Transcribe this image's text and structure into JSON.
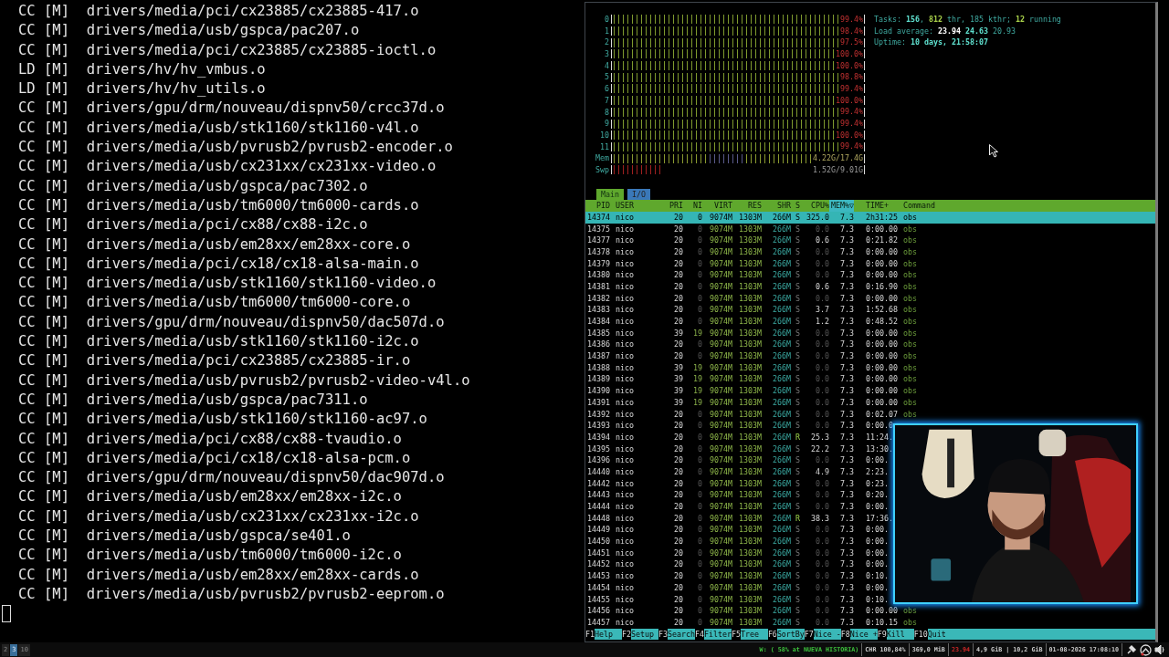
{
  "terminal": {
    "lines": [
      "CC [M]  drivers/media/pci/cx23885/cx23885-417.o",
      "CC [M]  drivers/media/usb/gspca/pac207.o",
      "CC [M]  drivers/media/pci/cx23885/cx23885-ioctl.o",
      "LD [M]  drivers/hv/hv_vmbus.o",
      "LD [M]  drivers/hv/hv_utils.o",
      "CC [M]  drivers/gpu/drm/nouveau/dispnv50/crcc37d.o",
      "CC [M]  drivers/media/usb/stk1160/stk1160-v4l.o",
      "CC [M]  drivers/media/usb/pvrusb2/pvrusb2-encoder.o",
      "CC [M]  drivers/media/usb/cx231xx/cx231xx-video.o",
      "CC [M]  drivers/media/usb/gspca/pac7302.o",
      "CC [M]  drivers/media/usb/tm6000/tm6000-cards.o",
      "CC [M]  drivers/media/pci/cx88/cx88-i2c.o",
      "CC [M]  drivers/media/usb/em28xx/em28xx-core.o",
      "CC [M]  drivers/media/pci/cx18/cx18-alsa-main.o",
      "CC [M]  drivers/media/usb/stk1160/stk1160-video.o",
      "CC [M]  drivers/media/usb/tm6000/tm6000-core.o",
      "CC [M]  drivers/gpu/drm/nouveau/dispnv50/dac507d.o",
      "CC [M]  drivers/media/usb/stk1160/stk1160-i2c.o",
      "CC [M]  drivers/media/pci/cx23885/cx23885-ir.o",
      "CC [M]  drivers/media/usb/pvrusb2/pvrusb2-video-v4l.o",
      "CC [M]  drivers/media/usb/gspca/pac7311.o",
      "CC [M]  drivers/media/usb/stk1160/stk1160-ac97.o",
      "CC [M]  drivers/media/pci/cx88/cx88-tvaudio.o",
      "CC [M]  drivers/media/pci/cx18/cx18-alsa-pcm.o",
      "CC [M]  drivers/gpu/drm/nouveau/dispnv50/dac907d.o",
      "CC [M]  drivers/media/usb/em28xx/em28xx-i2c.o",
      "CC [M]  drivers/media/usb/cx231xx/cx231xx-i2c.o",
      "CC [M]  drivers/media/usb/gspca/se401.o",
      "CC [M]  drivers/media/usb/tm6000/tm6000-i2c.o",
      "CC [M]  drivers/media/usb/em28xx/em28xx-cards.o",
      "CC [M]  drivers/media/usb/pvrusb2/pvrusb2-eeprom.o"
    ],
    "cursor_visible": true
  },
  "htop": {
    "meters": [
      {
        "kind": "cpu",
        "label": "0",
        "level": 0.994,
        "reading": "99.4%"
      },
      {
        "kind": "cpu",
        "label": "1",
        "level": 0.984,
        "reading": "98.4%"
      },
      {
        "kind": "cpu",
        "label": "2",
        "level": 0.975,
        "reading": "97.5%"
      },
      {
        "kind": "cpu",
        "label": "3",
        "level": 1.0,
        "reading": "100.0%"
      },
      {
        "kind": "cpu",
        "label": "4",
        "level": 1.0,
        "reading": "100.0%"
      },
      {
        "kind": "cpu",
        "label": "5",
        "level": 0.988,
        "reading": "98.8%"
      },
      {
        "kind": "cpu",
        "label": "6",
        "level": 0.994,
        "reading": "99.4%"
      },
      {
        "kind": "cpu",
        "label": "7",
        "level": 1.0,
        "reading": "100.0%"
      },
      {
        "kind": "cpu",
        "label": "8",
        "level": 0.994,
        "reading": "99.4%"
      },
      {
        "kind": "cpu",
        "label": "9",
        "level": 0.994,
        "reading": "99.4%"
      },
      {
        "kind": "cpu",
        "label": "10",
        "level": 1.0,
        "reading": "100.0%"
      },
      {
        "kind": "cpu",
        "label": "11",
        "level": 0.994,
        "reading": "99.4%"
      },
      {
        "kind": "mem",
        "label": "Mem",
        "level": 0.92,
        "reading": "4.22G/17.4G"
      },
      {
        "kind": "swap",
        "label": "Swp",
        "level": 0.2,
        "reading": "1.52G/9.01G"
      }
    ],
    "info": [
      [
        {
          "kind": "label",
          "text": "Tasks: "
        },
        {
          "kind": "value",
          "text": "156"
        },
        {
          "kind": "label",
          "text": ", "
        },
        {
          "kind": "green",
          "text": "812"
        },
        {
          "kind": "label",
          "text": " thr, 185 kthr; "
        },
        {
          "kind": "green",
          "text": "12"
        },
        {
          "kind": "label",
          "text": " running"
        }
      ],
      [
        {
          "kind": "label",
          "text": "Load average: "
        },
        {
          "kind": "white",
          "text": "23.94 "
        },
        {
          "kind": "value",
          "text": "24.63 "
        },
        {
          "kind": "label",
          "text": "20.93"
        }
      ],
      [
        {
          "kind": "label",
          "text": "Uptime: "
        },
        {
          "kind": "value",
          "text": "10 days, 21:58:07"
        }
      ]
    ],
    "tabs": [
      {
        "label": "Main",
        "selected": true
      },
      {
        "label": "I/O",
        "selected": false
      }
    ],
    "columns": [
      {
        "label": "PID",
        "sorted": false
      },
      {
        "label": "USER",
        "sorted": false
      },
      {
        "label": "PRI",
        "sorted": false
      },
      {
        "label": "NI",
        "sorted": false
      },
      {
        "label": "VIRT",
        "sorted": false
      },
      {
        "label": "RES",
        "sorted": false
      },
      {
        "label": "SHR",
        "sorted": false
      },
      {
        "label": "S",
        "sorted": false
      },
      {
        "label": "CPU%",
        "sorted": false
      },
      {
        "label": "MEM%▽",
        "sorted": true
      },
      {
        "label": "TIME+",
        "sorted": false
      },
      {
        "label": "Command",
        "sorted": false
      }
    ],
    "rows": [
      {
        "pid": "14374",
        "user": "nico",
        "pri": "20",
        "ni": "0",
        "virt": "9074M",
        "res": "1303M",
        "shr": "266M",
        "s": "S",
        "cpu": "325.0",
        "mem": "7.3",
        "time": "2h31:25",
        "command": "obs",
        "selected": true,
        "running": false
      },
      {
        "pid": "14375",
        "user": "nico",
        "pri": "20",
        "ni": "0",
        "virt": "9074M",
        "res": "1303M",
        "shr": "266M",
        "s": "S",
        "cpu": "0.0",
        "mem": "7.3",
        "time": "0:00.00",
        "command": "obs",
        "selected": false,
        "running": false
      },
      {
        "pid": "14377",
        "user": "nico",
        "pri": "20",
        "ni": "0",
        "virt": "9074M",
        "res": "1303M",
        "shr": "266M",
        "s": "S",
        "cpu": "0.6",
        "mem": "7.3",
        "time": "0:21.82",
        "command": "obs",
        "selected": false,
        "running": false
      },
      {
        "pid": "14378",
        "user": "nico",
        "pri": "20",
        "ni": "0",
        "virt": "9074M",
        "res": "1303M",
        "shr": "266M",
        "s": "S",
        "cpu": "0.0",
        "mem": "7.3",
        "time": "0:00.00",
        "command": "obs",
        "selected": false,
        "running": false
      },
      {
        "pid": "14379",
        "user": "nico",
        "pri": "20",
        "ni": "0",
        "virt": "9074M",
        "res": "1303M",
        "shr": "266M",
        "s": "S",
        "cpu": "0.0",
        "mem": "7.3",
        "time": "0:00.00",
        "command": "obs",
        "selected": false,
        "running": false
      },
      {
        "pid": "14380",
        "user": "nico",
        "pri": "20",
        "ni": "0",
        "virt": "9074M",
        "res": "1303M",
        "shr": "266M",
        "s": "S",
        "cpu": "0.0",
        "mem": "7.3",
        "time": "0:00.00",
        "command": "obs",
        "selected": false,
        "running": false
      },
      {
        "pid": "14381",
        "user": "nico",
        "pri": "20",
        "ni": "0",
        "virt": "9074M",
        "res": "1303M",
        "shr": "266M",
        "s": "S",
        "cpu": "0.6",
        "mem": "7.3",
        "time": "0:16.90",
        "command": "obs",
        "selected": false,
        "running": false
      },
      {
        "pid": "14382",
        "user": "nico",
        "pri": "20",
        "ni": "0",
        "virt": "9074M",
        "res": "1303M",
        "shr": "266M",
        "s": "S",
        "cpu": "0.0",
        "mem": "7.3",
        "time": "0:00.00",
        "command": "obs",
        "selected": false,
        "running": false
      },
      {
        "pid": "14383",
        "user": "nico",
        "pri": "20",
        "ni": "0",
        "virt": "9074M",
        "res": "1303M",
        "shr": "266M",
        "s": "S",
        "cpu": "3.7",
        "mem": "7.3",
        "time": "1:52.68",
        "command": "obs",
        "selected": false,
        "running": false
      },
      {
        "pid": "14384",
        "user": "nico",
        "pri": "20",
        "ni": "0",
        "virt": "9074M",
        "res": "1303M",
        "shr": "266M",
        "s": "S",
        "cpu": "1.2",
        "mem": "7.3",
        "time": "0:48.52",
        "command": "obs",
        "selected": false,
        "running": false
      },
      {
        "pid": "14385",
        "user": "nico",
        "pri": "39",
        "ni": "19",
        "virt": "9074M",
        "res": "1303M",
        "shr": "266M",
        "s": "S",
        "cpu": "0.0",
        "mem": "7.3",
        "time": "0:00.00",
        "command": "obs",
        "selected": false,
        "running": false
      },
      {
        "pid": "14386",
        "user": "nico",
        "pri": "20",
        "ni": "0",
        "virt": "9074M",
        "res": "1303M",
        "shr": "266M",
        "s": "S",
        "cpu": "0.0",
        "mem": "7.3",
        "time": "0:00.00",
        "command": "obs",
        "selected": false,
        "running": false
      },
      {
        "pid": "14387",
        "user": "nico",
        "pri": "20",
        "ni": "0",
        "virt": "9074M",
        "res": "1303M",
        "shr": "266M",
        "s": "S",
        "cpu": "0.0",
        "mem": "7.3",
        "time": "0:00.00",
        "command": "obs",
        "selected": false,
        "running": false
      },
      {
        "pid": "14388",
        "user": "nico",
        "pri": "39",
        "ni": "19",
        "virt": "9074M",
        "res": "1303M",
        "shr": "266M",
        "s": "S",
        "cpu": "0.0",
        "mem": "7.3",
        "time": "0:00.00",
        "command": "obs",
        "selected": false,
        "running": false
      },
      {
        "pid": "14389",
        "user": "nico",
        "pri": "39",
        "ni": "19",
        "virt": "9074M",
        "res": "1303M",
        "shr": "266M",
        "s": "S",
        "cpu": "0.0",
        "mem": "7.3",
        "time": "0:00.00",
        "command": "obs",
        "selected": false,
        "running": false
      },
      {
        "pid": "14390",
        "user": "nico",
        "pri": "39",
        "ni": "19",
        "virt": "9074M",
        "res": "1303M",
        "shr": "266M",
        "s": "S",
        "cpu": "0.0",
        "mem": "7.3",
        "time": "0:00.00",
        "command": "obs",
        "selected": false,
        "running": false
      },
      {
        "pid": "14391",
        "user": "nico",
        "pri": "39",
        "ni": "19",
        "virt": "9074M",
        "res": "1303M",
        "shr": "266M",
        "s": "S",
        "cpu": "0.0",
        "mem": "7.3",
        "time": "0:00.00",
        "command": "obs",
        "selected": false,
        "running": false
      },
      {
        "pid": "14392",
        "user": "nico",
        "pri": "20",
        "ni": "0",
        "virt": "9074M",
        "res": "1303M",
        "shr": "266M",
        "s": "S",
        "cpu": "0.0",
        "mem": "7.3",
        "time": "0:02.07",
        "command": "obs",
        "selected": false,
        "running": false
      },
      {
        "pid": "14393",
        "user": "nico",
        "pri": "20",
        "ni": "0",
        "virt": "9074M",
        "res": "1303M",
        "shr": "266M",
        "s": "S",
        "cpu": "0.0",
        "mem": "7.3",
        "time": "0:00.0",
        "selected": false,
        "running": false
      },
      {
        "pid": "14394",
        "user": "nico",
        "pri": "20",
        "ni": "0",
        "virt": "9074M",
        "res": "1303M",
        "shr": "266M",
        "s": "R",
        "cpu": "25.3",
        "mem": "7.3",
        "time": "11:24.",
        "selected": false,
        "running": true
      },
      {
        "pid": "14395",
        "user": "nico",
        "pri": "20",
        "ni": "0",
        "virt": "9074M",
        "res": "1303M",
        "shr": "266M",
        "s": "S",
        "cpu": "22.2",
        "mem": "7.3",
        "time": "13:30.",
        "selected": false,
        "running": false
      },
      {
        "pid": "14396",
        "user": "nico",
        "pri": "20",
        "ni": "0",
        "virt": "9074M",
        "res": "1303M",
        "shr": "266M",
        "s": "S",
        "cpu": "0.0",
        "mem": "7.3",
        "time": "0:00.",
        "selected": false,
        "running": false
      },
      {
        "pid": "14440",
        "user": "nico",
        "pri": "20",
        "ni": "0",
        "virt": "9074M",
        "res": "1303M",
        "shr": "266M",
        "s": "S",
        "cpu": "4.9",
        "mem": "7.3",
        "time": "2:23.",
        "selected": false,
        "running": false
      },
      {
        "pid": "14442",
        "user": "nico",
        "pri": "20",
        "ni": "0",
        "virt": "9074M",
        "res": "1303M",
        "shr": "266M",
        "s": "S",
        "cpu": "0.0",
        "mem": "7.3",
        "time": "0:23.",
        "selected": false,
        "running": false
      },
      {
        "pid": "14443",
        "user": "nico",
        "pri": "20",
        "ni": "0",
        "virt": "9074M",
        "res": "1303M",
        "shr": "266M",
        "s": "S",
        "cpu": "0.0",
        "mem": "7.3",
        "time": "0:20.",
        "selected": false,
        "running": false
      },
      {
        "pid": "14444",
        "user": "nico",
        "pri": "20",
        "ni": "0",
        "virt": "9074M",
        "res": "1303M",
        "shr": "266M",
        "s": "S",
        "cpu": "0.0",
        "mem": "7.3",
        "time": "0:00.",
        "selected": false,
        "running": false
      },
      {
        "pid": "14448",
        "user": "nico",
        "pri": "20",
        "ni": "0",
        "virt": "9074M",
        "res": "1303M",
        "shr": "266M",
        "s": "R",
        "cpu": "38.3",
        "mem": "7.3",
        "time": "17:36.",
        "selected": false,
        "running": true
      },
      {
        "pid": "14449",
        "user": "nico",
        "pri": "20",
        "ni": "0",
        "virt": "9074M",
        "res": "1303M",
        "shr": "266M",
        "s": "S",
        "cpu": "0.0",
        "mem": "7.3",
        "time": "0:00.",
        "selected": false,
        "running": false
      },
      {
        "pid": "14450",
        "user": "nico",
        "pri": "20",
        "ni": "0",
        "virt": "9074M",
        "res": "1303M",
        "shr": "266M",
        "s": "S",
        "cpu": "0.0",
        "mem": "7.3",
        "time": "0:00.",
        "selected": false,
        "running": false
      },
      {
        "pid": "14451",
        "user": "nico",
        "pri": "20",
        "ni": "0",
        "virt": "9074M",
        "res": "1303M",
        "shr": "266M",
        "s": "S",
        "cpu": "0.0",
        "mem": "7.3",
        "time": "0:00.",
        "selected": false,
        "running": false
      },
      {
        "pid": "14452",
        "user": "nico",
        "pri": "20",
        "ni": "0",
        "virt": "9074M",
        "res": "1303M",
        "shr": "266M",
        "s": "S",
        "cpu": "0.0",
        "mem": "7.3",
        "time": "0:00.",
        "selected": false,
        "running": false
      },
      {
        "pid": "14453",
        "user": "nico",
        "pri": "20",
        "ni": "0",
        "virt": "9074M",
        "res": "1303M",
        "shr": "266M",
        "s": "S",
        "cpu": "0.0",
        "mem": "7.3",
        "time": "0:10.",
        "selected": false,
        "running": false
      },
      {
        "pid": "14454",
        "user": "nico",
        "pri": "20",
        "ni": "0",
        "virt": "9074M",
        "res": "1303M",
        "shr": "266M",
        "s": "S",
        "cpu": "0.0",
        "mem": "7.3",
        "time": "0:00.",
        "selected": false,
        "running": false
      },
      {
        "pid": "14455",
        "user": "nico",
        "pri": "20",
        "ni": "0",
        "virt": "9074M",
        "res": "1303M",
        "shr": "266M",
        "s": "S",
        "cpu": "0.0",
        "mem": "7.3",
        "time": "0:10.",
        "selected": false,
        "running": false
      },
      {
        "pid": "14456",
        "user": "nico",
        "pri": "20",
        "ni": "0",
        "virt": "9074M",
        "res": "1303M",
        "shr": "266M",
        "s": "S",
        "cpu": "0.0",
        "mem": "7.3",
        "time": "0:00.00",
        "command": "obs",
        "selected": false,
        "running": false
      },
      {
        "pid": "14457",
        "user": "nico",
        "pri": "20",
        "ni": "0",
        "virt": "9074M",
        "res": "1303M",
        "shr": "266M",
        "s": "S",
        "cpu": "0.0",
        "mem": "7.3",
        "time": "0:10.15",
        "command": "obs",
        "selected": false,
        "running": false
      }
    ],
    "function_keys": [
      {
        "key": "F1",
        "label": "Help"
      },
      {
        "key": "F2",
        "label": "Setup"
      },
      {
        "key": "F3",
        "label": "Search"
      },
      {
        "key": "F4",
        "label": "Filter"
      },
      {
        "key": "F5",
        "label": "Tree"
      },
      {
        "key": "F6",
        "label": "SortBy"
      },
      {
        "key": "F7",
        "label": "Nice -"
      },
      {
        "key": "F8",
        "label": "Nice +"
      },
      {
        "key": "F9",
        "label": "Kill"
      },
      {
        "key": "F10",
        "label": "Quit"
      }
    ],
    "webcam": {
      "kind": "picture"
    }
  },
  "status_bar": {
    "workspaces": [
      {
        "label": "2",
        "selected": false
      },
      {
        "label": "3",
        "selected": true
      },
      {
        "label": "10",
        "selected": false
      }
    ],
    "items": [
      {
        "text": "W: ( 58% at NUEVA HISTORIA)",
        "kind": "network"
      },
      {
        "text": "CHR 100,84%",
        "kind": "plain"
      },
      {
        "text": "369,0 MiB",
        "kind": "plain"
      },
      {
        "text": "23.94",
        "kind": "alert"
      },
      {
        "text": "4,9 GiB | 10,2 GiB",
        "kind": "plain"
      },
      {
        "text": "01-08-2026 17:08:10",
        "kind": "plain"
      }
    ]
  }
}
